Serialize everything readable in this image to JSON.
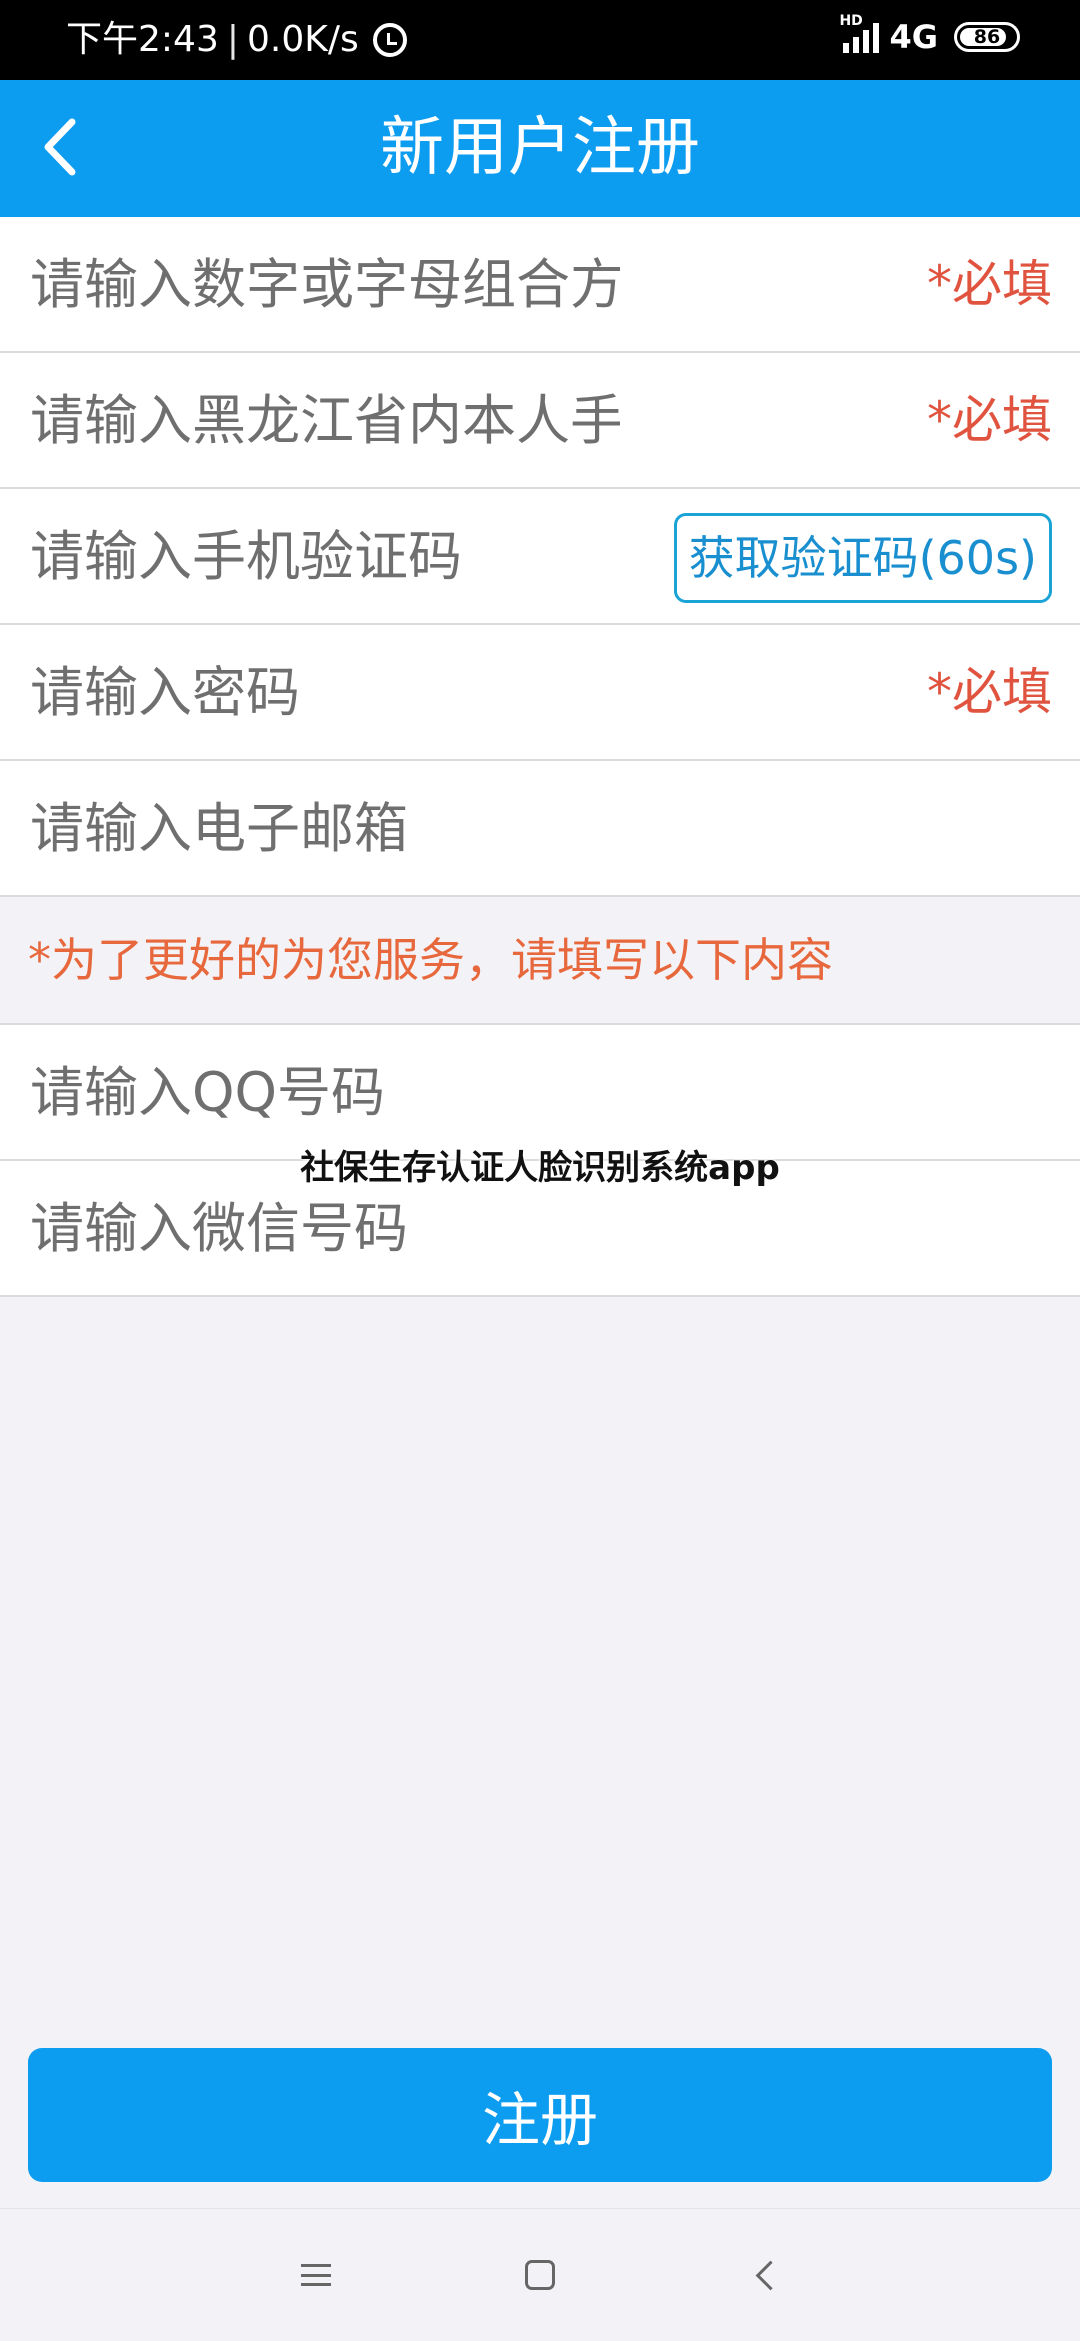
{
  "status_bar": {
    "time": "下午2:43",
    "separator": "|",
    "net_speed": "0.0K/s",
    "alarm_icon": "alarm-clock-icon",
    "hd_label": "HD",
    "network": "4G",
    "battery": "86",
    "battery_level": 0.86
  },
  "app_bar": {
    "back_icon": "chevron-left-icon",
    "title": "新用户注册"
  },
  "form": {
    "username_placeholder": "请输入数字或字母组合方式的用户名",
    "username_required": "*必填",
    "phone_placeholder": "请输入黑龙江省内本人手机号",
    "phone_required": "*必填",
    "sms_code_placeholder": "请输入手机验证码",
    "get_code_button": "获取验证码(60s)",
    "password_placeholder": "请输入密码",
    "password_required": "*必填",
    "email_placeholder": "请输入电子邮箱",
    "optional_notice": "*为了更好的为您服务，请填写以下内容",
    "qq_placeholder": "请输入QQ号码",
    "wechat_placeholder": "请输入微信号码"
  },
  "watermark": "社保生存认证人脸识别系统app",
  "register_button": "注册",
  "nav_bar": {
    "menu_icon": "menu-icon",
    "home_icon": "home-square-icon",
    "back_icon": "back-triangle-icon"
  },
  "colors": {
    "accent": "#0c9cf0",
    "required": "#e0533f",
    "notice": "#e8683d",
    "background": "#f3f3f7"
  }
}
